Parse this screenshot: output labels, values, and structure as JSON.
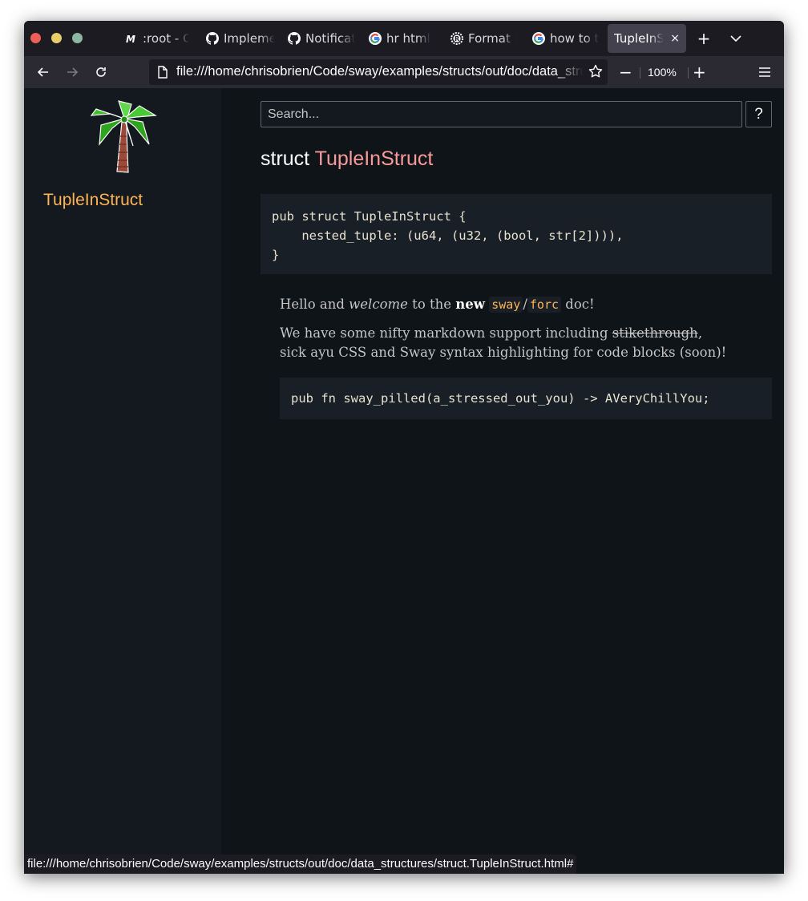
{
  "browser": {
    "tabs": [
      {
        "label": ":root - C",
        "favicon": "mdn-icon"
      },
      {
        "label": "Impleme",
        "favicon": "github-icon"
      },
      {
        "label": "Notificat",
        "favicon": "github-icon"
      },
      {
        "label": "hr html",
        "favicon": "google-icon"
      },
      {
        "label": "Format i",
        "favicon": "rust-icon"
      },
      {
        "label": "how to t",
        "favicon": "google-icon"
      },
      {
        "label": "TupleInSt",
        "favicon": "none",
        "active": true
      }
    ],
    "new_tab_symbol": "+",
    "tab_list_symbol": "⌄",
    "close_tab_symbol": "×",
    "url": "file:///home/chrisobrien/Code/sway/examples/structs/out/doc/data_structures/struct.TupleInStruct.html",
    "zoom": "100%",
    "zoom_minus": "−",
    "zoom_plus": "+",
    "status_url": "file:///home/chrisobrien/Code/sway/examples/structs/out/doc/data_structures/struct.TupleInStruct.html#"
  },
  "sidebar": {
    "title": "TupleInStruct",
    "logo": "palm-tree-icon"
  },
  "search": {
    "placeholder": "Search...",
    "help_label": "?"
  },
  "main": {
    "heading_kind": "struct",
    "heading_name": "TupleInStruct",
    "declaration": "pub struct TupleInStruct {\n    nested_tuple: (u64, (u32, (bool, str[2]))),\n}",
    "doc": {
      "p1_a": "Hello and ",
      "p1_em": "welcome",
      "p1_b": " to the ",
      "p1_strong": "new",
      "p1_code1": "sway",
      "p1_sep": "/",
      "p1_code2": "forc",
      "p1_c": " doc!",
      "p2_a": "We have some nifty markdown support including ",
      "p2_strike": "stikethrough",
      "p2_b": ",",
      "p2_c": "sick ayu CSS and Sway syntax highlighting for code blocks (soon)!",
      "code": "pub fn sway_pilled(a_stressed_out_you) -> AVeryChillYou;"
    }
  },
  "colors": {
    "background": "#0f1419",
    "sidebar": "#14191f",
    "accent_orange": "#ffb454",
    "type_name": "#f89a9a",
    "code_bg": "#191f26"
  }
}
